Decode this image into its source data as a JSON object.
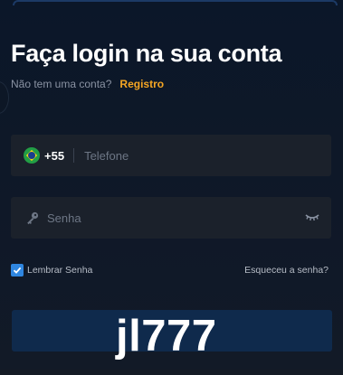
{
  "login": {
    "title": "Faça login na sua conta",
    "no_account_text": "Não tem uma conta?",
    "register_link": "Registro"
  },
  "phone": {
    "country_flag_icon": "brazil-flag-icon",
    "dial_code": "+55",
    "value": "",
    "placeholder": "Telefone"
  },
  "password": {
    "leading_icon": "key-icon",
    "value": "",
    "placeholder": "Senha",
    "toggle_icon": "eye-closed-icon"
  },
  "options": {
    "remember_checked": true,
    "remember_label": "Lembrar Senha",
    "forgot_link": "Esqueceu a senha?"
  },
  "submit": {
    "label": ""
  },
  "watermark": {
    "text": "jl777"
  },
  "colors": {
    "background": "#0b1526",
    "field_background": "#1b212b",
    "accent_link": "#f5a623",
    "checkbox": "#2f86e0",
    "button": "#0f2a4c"
  }
}
